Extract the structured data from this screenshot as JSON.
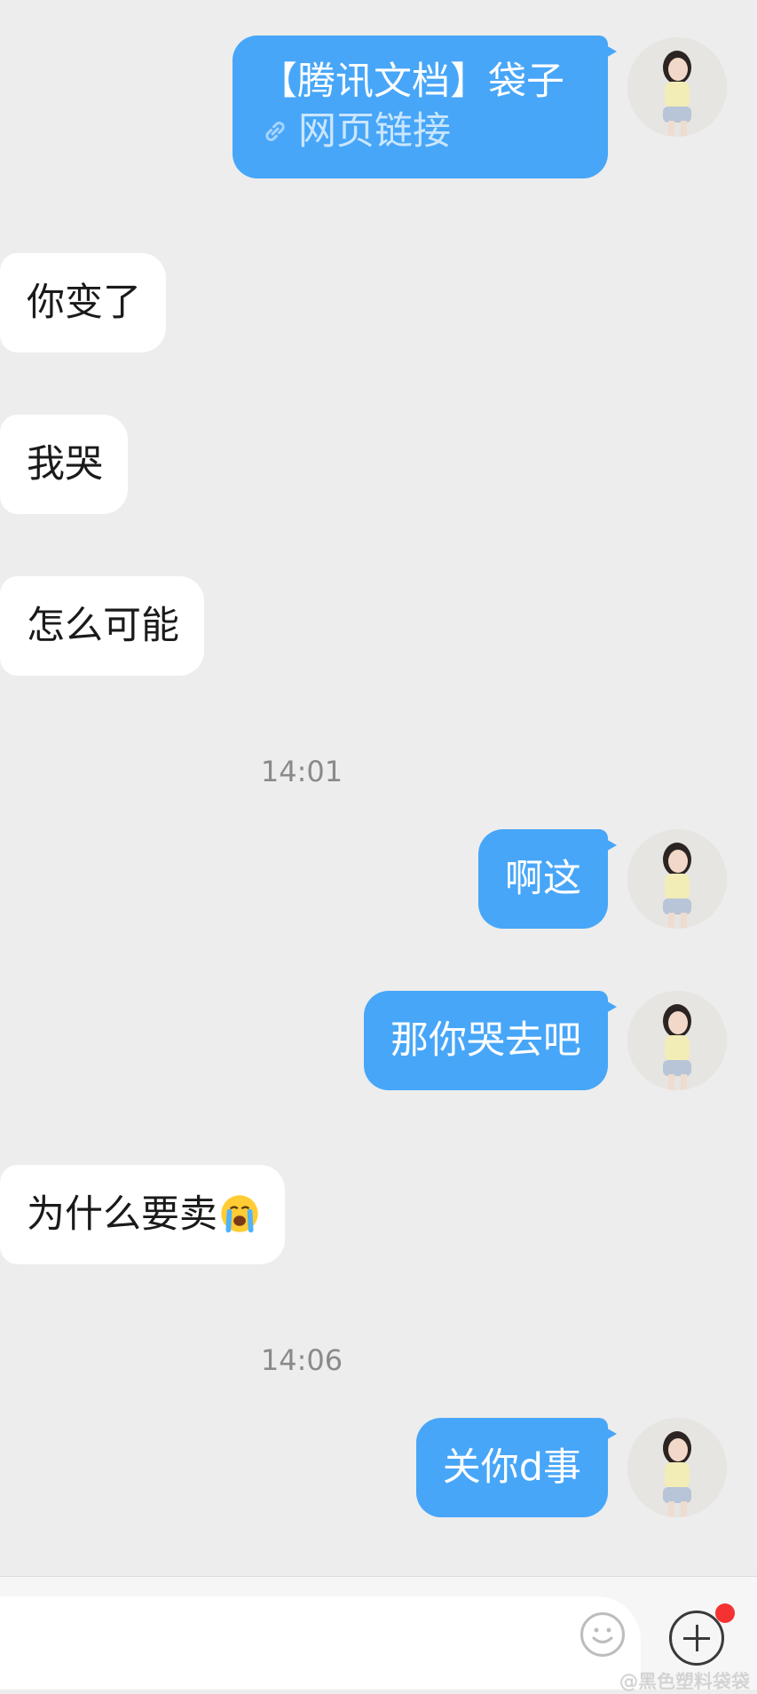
{
  "messages": [
    {
      "side": "out",
      "title": "【腾讯文档】袋子",
      "link_label": "网页链接",
      "link_icon": "link-icon"
    },
    {
      "side": "in",
      "text": "你变了"
    },
    {
      "side": "in",
      "text": "我哭"
    },
    {
      "side": "in",
      "text": "怎么可能"
    },
    {
      "timestamp": "14:01"
    },
    {
      "side": "out",
      "text": "啊这"
    },
    {
      "side": "out",
      "text": "那你哭去吧"
    },
    {
      "side": "in",
      "text": "为什么要卖",
      "emoji": "loudly-crying-face"
    },
    {
      "timestamp": "14:06"
    },
    {
      "side": "out",
      "text": "关你d事"
    }
  ],
  "composer": {
    "input_value": "",
    "emoji_button_icon": "smiley-icon",
    "plus_button_icon": "plus-circle-icon",
    "notification_dot_color": "#f53232"
  },
  "watermark": "@黑色塑料袋袋",
  "colors": {
    "outgoing_bubble": "#47a6f8",
    "incoming_bubble": "#ffffff",
    "background": "#ededed"
  }
}
